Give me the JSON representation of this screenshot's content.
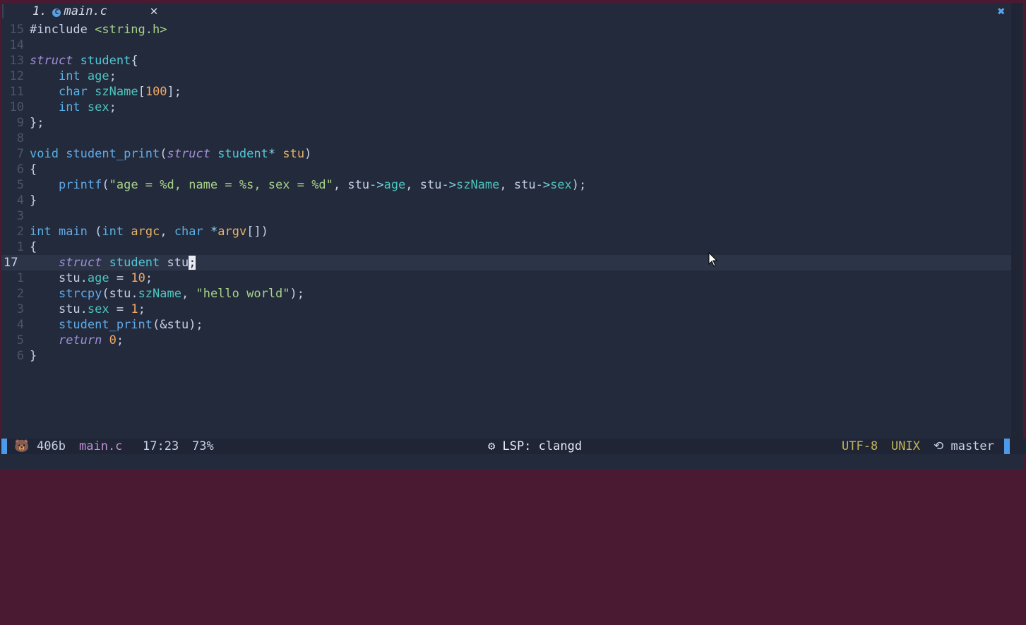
{
  "tabline": {
    "tab_number": "1.",
    "tab_icon": "c-file-icon",
    "tab_filename": "main.c",
    "tab_close": "✕",
    "window_close": "✖"
  },
  "editor": {
    "lines": [
      {
        "num": "15",
        "tokens": [
          {
            "c": "pn",
            "t": "#include "
          },
          {
            "c": "st",
            "t": "<string.h>"
          }
        ]
      },
      {
        "num": "14",
        "tokens": []
      },
      {
        "num": "13",
        "tokens": [
          {
            "c": "kwi",
            "t": "struct"
          },
          {
            "c": "pn",
            "t": " "
          },
          {
            "c": "ty",
            "t": "student"
          },
          {
            "c": "pn",
            "t": "{"
          }
        ]
      },
      {
        "num": "12",
        "tokens": [
          {
            "c": "pn",
            "t": "    "
          },
          {
            "c": "kw",
            "t": "int"
          },
          {
            "c": "pn",
            "t": " "
          },
          {
            "c": "fld",
            "t": "age"
          },
          {
            "c": "pn",
            "t": ";"
          }
        ]
      },
      {
        "num": "11",
        "tokens": [
          {
            "c": "pn",
            "t": "    "
          },
          {
            "c": "kw",
            "t": "char"
          },
          {
            "c": "pn",
            "t": " "
          },
          {
            "c": "fld",
            "t": "szName"
          },
          {
            "c": "pn",
            "t": "["
          },
          {
            "c": "nm",
            "t": "100"
          },
          {
            "c": "pn",
            "t": "];"
          }
        ]
      },
      {
        "num": "10",
        "tokens": [
          {
            "c": "pn",
            "t": "    "
          },
          {
            "c": "kw",
            "t": "int"
          },
          {
            "c": "pn",
            "t": " "
          },
          {
            "c": "fld",
            "t": "sex"
          },
          {
            "c": "pn",
            "t": ";"
          }
        ]
      },
      {
        "num": "9",
        "tokens": [
          {
            "c": "pn",
            "t": "};"
          }
        ]
      },
      {
        "num": "8",
        "tokens": []
      },
      {
        "num": "7",
        "tokens": [
          {
            "c": "kw",
            "t": "void"
          },
          {
            "c": "pn",
            "t": " "
          },
          {
            "c": "fn",
            "t": "student_print"
          },
          {
            "c": "pn",
            "t": "("
          },
          {
            "c": "kwi",
            "t": "struct"
          },
          {
            "c": "pn",
            "t": " "
          },
          {
            "c": "ty",
            "t": "student"
          },
          {
            "c": "op",
            "t": "*"
          },
          {
            "c": "pn",
            "t": " "
          },
          {
            "c": "pr",
            "t": "stu"
          },
          {
            "c": "pn",
            "t": ")"
          }
        ]
      },
      {
        "num": "6",
        "tokens": [
          {
            "c": "pn",
            "t": "{"
          }
        ]
      },
      {
        "num": "5",
        "tokens": [
          {
            "c": "pn",
            "t": "    "
          },
          {
            "c": "fn",
            "t": "printf"
          },
          {
            "c": "pn",
            "t": "("
          },
          {
            "c": "st",
            "t": "\"age = %d, name = %s, sex = %d\""
          },
          {
            "c": "pn",
            "t": ", stu"
          },
          {
            "c": "op",
            "t": "->"
          },
          {
            "c": "fld",
            "t": "age"
          },
          {
            "c": "pn",
            "t": ", stu"
          },
          {
            "c": "op",
            "t": "->"
          },
          {
            "c": "fld",
            "t": "szName"
          },
          {
            "c": "pn",
            "t": ", stu"
          },
          {
            "c": "op",
            "t": "->"
          },
          {
            "c": "fld",
            "t": "sex"
          },
          {
            "c": "pn",
            "t": ");"
          }
        ]
      },
      {
        "num": "4",
        "tokens": [
          {
            "c": "pn",
            "t": "}"
          }
        ]
      },
      {
        "num": "3",
        "tokens": []
      },
      {
        "num": "2",
        "tokens": [
          {
            "c": "kw",
            "t": "int"
          },
          {
            "c": "pn",
            "t": " "
          },
          {
            "c": "fn",
            "t": "main"
          },
          {
            "c": "pn",
            "t": " ("
          },
          {
            "c": "kw",
            "t": "int"
          },
          {
            "c": "pn",
            "t": " "
          },
          {
            "c": "pr",
            "t": "argc"
          },
          {
            "c": "pn",
            "t": ", "
          },
          {
            "c": "kw",
            "t": "char"
          },
          {
            "c": "pn",
            "t": " "
          },
          {
            "c": "op",
            "t": "*"
          },
          {
            "c": "pr",
            "t": "argv"
          },
          {
            "c": "pn",
            "t": "[])"
          }
        ]
      },
      {
        "num": "1",
        "tokens": [
          {
            "c": "pn",
            "t": "{"
          }
        ]
      },
      {
        "num": "17",
        "current": true,
        "tokens": [
          {
            "c": "pn",
            "t": "    "
          },
          {
            "c": "kwi",
            "t": "struct"
          },
          {
            "c": "pn",
            "t": " "
          },
          {
            "c": "ty",
            "t": "student"
          },
          {
            "c": "pn",
            "t": " stu"
          },
          {
            "c": "cursor",
            "t": ";"
          }
        ]
      },
      {
        "num": "1",
        "tokens": [
          {
            "c": "pn",
            "t": "    stu."
          },
          {
            "c": "fld",
            "t": "age"
          },
          {
            "c": "pn",
            "t": " = "
          },
          {
            "c": "nm",
            "t": "10"
          },
          {
            "c": "pn",
            "t": ";"
          }
        ]
      },
      {
        "num": "2",
        "tokens": [
          {
            "c": "pn",
            "t": "    "
          },
          {
            "c": "fn",
            "t": "strcpy"
          },
          {
            "c": "pn",
            "t": "(stu."
          },
          {
            "c": "fld",
            "t": "szName"
          },
          {
            "c": "pn",
            "t": ", "
          },
          {
            "c": "st",
            "t": "\"hello world\""
          },
          {
            "c": "pn",
            "t": ");"
          }
        ]
      },
      {
        "num": "3",
        "tokens": [
          {
            "c": "pn",
            "t": "    stu."
          },
          {
            "c": "fld",
            "t": "sex"
          },
          {
            "c": "pn",
            "t": " = "
          },
          {
            "c": "nm",
            "t": "1"
          },
          {
            "c": "pn",
            "t": ";"
          }
        ]
      },
      {
        "num": "4",
        "tokens": [
          {
            "c": "pn",
            "t": "    "
          },
          {
            "c": "fn",
            "t": "student_print"
          },
          {
            "c": "pn",
            "t": "(&stu);"
          }
        ]
      },
      {
        "num": "5",
        "tokens": [
          {
            "c": "pn",
            "t": "    "
          },
          {
            "c": "kwi",
            "t": "return"
          },
          {
            "c": "pn",
            "t": " "
          },
          {
            "c": "nm",
            "t": "0"
          },
          {
            "c": "pn",
            "t": ";"
          }
        ]
      },
      {
        "num": "6",
        "tokens": [
          {
            "c": "pn",
            "t": "}"
          }
        ]
      }
    ]
  },
  "statusline": {
    "mode_icon": "🐻",
    "size": "406b",
    "filename": "main.c",
    "position": "17:23",
    "percent": "73%",
    "lsp": "⚙ LSP: clangd",
    "encoding": "UTF-8",
    "fileformat": "UNIX",
    "branch": "⟲ master"
  },
  "colors": {
    "background": "#232a3b",
    "accent": "#4d9be8",
    "frame": "#4a1a33"
  }
}
